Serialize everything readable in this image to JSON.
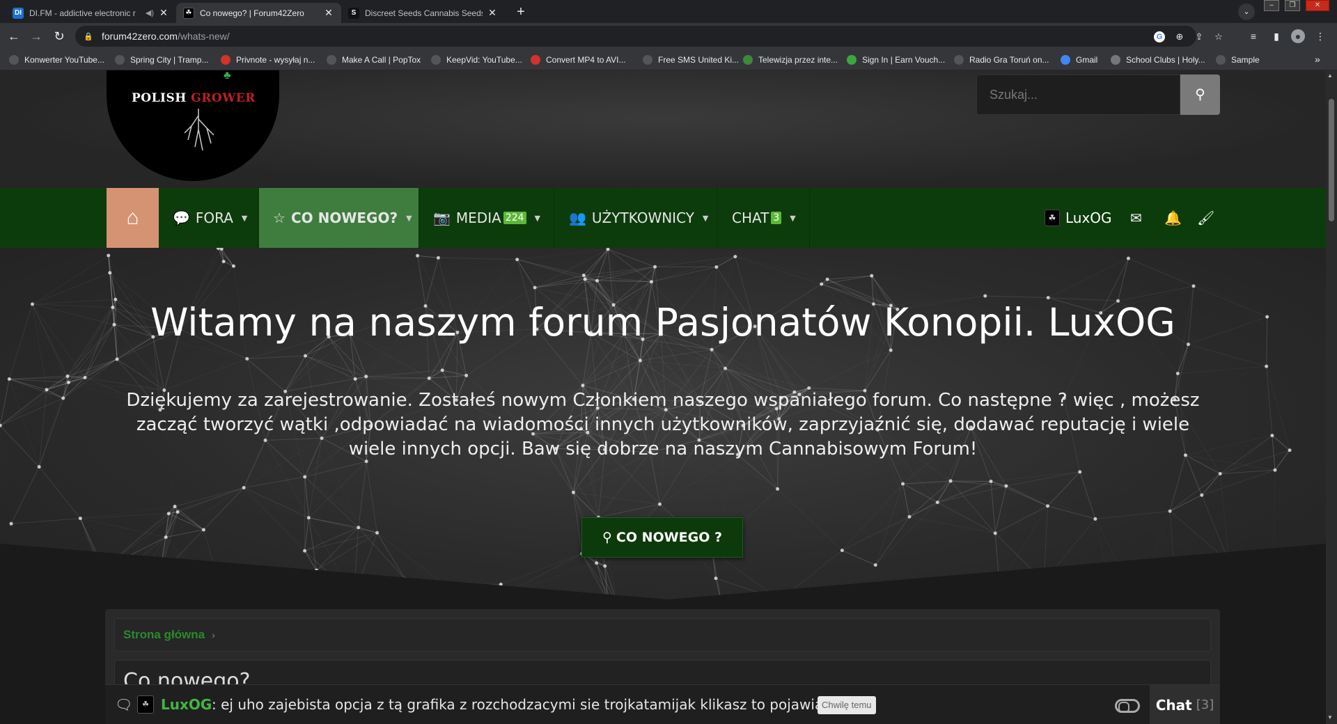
{
  "browser": {
    "tabs": [
      {
        "title": "DI.FM - addictive electronic r",
        "favicon": "DI",
        "favicon_color": "#1d6fd0",
        "active": false
      },
      {
        "title": "Co nowego? | Forum42Zero",
        "favicon": "F",
        "favicon_color": "#000000",
        "active": true
      },
      {
        "title": "Discreet Seeds Cannabis Seeds | ",
        "favicon": "S",
        "favicon_color": "#111111",
        "active": false
      }
    ],
    "new_tab": "+",
    "url_host": "forum42zero.com",
    "url_path": "/whats-new/",
    "bookmarks": [
      {
        "label": "Konwerter YouTube...",
        "color": "#555"
      },
      {
        "label": "Spring City | Tramp...",
        "color": "#555"
      },
      {
        "label": "Privnote - wysyłaj n...",
        "color": "#d0342c"
      },
      {
        "label": "Make A Call | PopTox",
        "color": "#555"
      },
      {
        "label": "KeepVid: YouTube...",
        "color": "#555"
      },
      {
        "label": "Convert MP4 to AVI...",
        "color": "#d0342c"
      },
      {
        "label": "Free SMS United Ki...",
        "color": "#555"
      },
      {
        "label": "Telewizja przez inte...",
        "color": "#3a8a3a"
      },
      {
        "label": "Sign In | Earn Vouch...",
        "color": "#3aa83a"
      },
      {
        "label": "Radio Gra Toruń on...",
        "color": "#555"
      },
      {
        "label": "Gmail",
        "color": "#4285f4"
      },
      {
        "label": "School Clubs | Holy...",
        "color": "#777"
      },
      {
        "label": "Sample",
        "color": "#555"
      }
    ],
    "bookmarks_more": "»"
  },
  "header": {
    "logo_text_1": "POLISH ",
    "logo_text_2": "GROWER",
    "search_placeholder": "Szukaj..."
  },
  "nav": {
    "items": [
      {
        "label": "FORA",
        "icon": "comments-icon"
      },
      {
        "label": "CO NOWEGO?",
        "icon": "star-icon",
        "active": true
      },
      {
        "label": "MEDIA",
        "icon": "camera-icon",
        "badge": "224"
      },
      {
        "label": "UŻYTKOWNICY",
        "icon": "users-icon"
      },
      {
        "label": "CHAT",
        "icon": "chat-icon",
        "badge": "3"
      }
    ],
    "user": "LuxOG",
    "colors": {
      "bar": "#0d3c0c",
      "active": "#3f7d3e",
      "home": "#d69374"
    }
  },
  "hero": {
    "title": "Witamy na naszym forum Pasjonatów Konopii. LuxOG",
    "text": "Dziękujemy za zarejestrowanie. Zostałeś nowym Członkiem naszego wspaniałego forum. Co następne ? więc , możesz zacząć tworzyć wątki ,odpowiadać na wiadomości innych użytkowników, zaprzyjaźnić się, dodawać reputację i wiele wiele innych opcji. Baw się dobrze na naszym Cannabisowym Forum!",
    "button": "CO NOWEGO ?"
  },
  "main": {
    "breadcrumb": "Strona główna",
    "page_title": "Co nowego?"
  },
  "chat": {
    "user": "LuxOG",
    "message": ": ej uho zajebista opcja z tą grafika z rozchodzacymi sie trojkatamijak klikasz to pojawiaja sie...",
    "tag": "Chwilę temu",
    "tab_label": "Chat",
    "tab_count": "[3]"
  }
}
